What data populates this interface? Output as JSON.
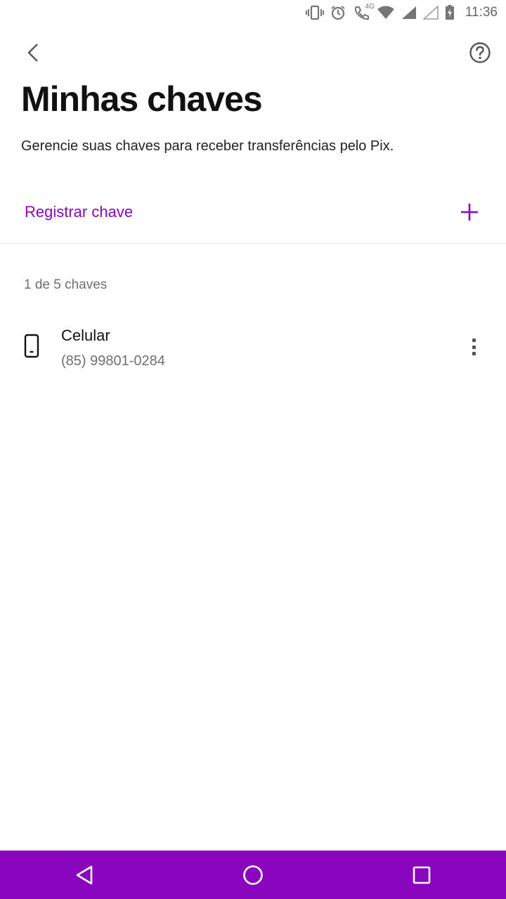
{
  "status_bar": {
    "time": "11:36",
    "network_label": "4G",
    "icons": [
      "vibrate-icon",
      "alarm-icon",
      "wifi-calling-icon",
      "wifi-icon",
      "signal-icon",
      "signal-empty-icon",
      "battery-charging-icon"
    ]
  },
  "header": {
    "back_icon": "chevron-left-icon",
    "help_icon": "help-circle-icon",
    "title": "Minhas chaves",
    "subtitle": "Gerencie suas chaves para receber transferências pelo Pix."
  },
  "register": {
    "label": "Registrar chave",
    "icon": "plus-icon"
  },
  "keys": {
    "count_label": "1 de 5 chaves",
    "items": [
      {
        "type": "Celular",
        "value": "(85) 99801-0284",
        "icon": "smartphone-icon",
        "menu_icon": "more-vertical-icon"
      }
    ]
  },
  "navigation": {
    "buttons": [
      "back-triangle-icon",
      "home-circle-icon",
      "recents-square-icon"
    ]
  },
  "colors": {
    "accent": "#8a05be",
    "text_primary": "#111111",
    "text_secondary": "#707070"
  }
}
